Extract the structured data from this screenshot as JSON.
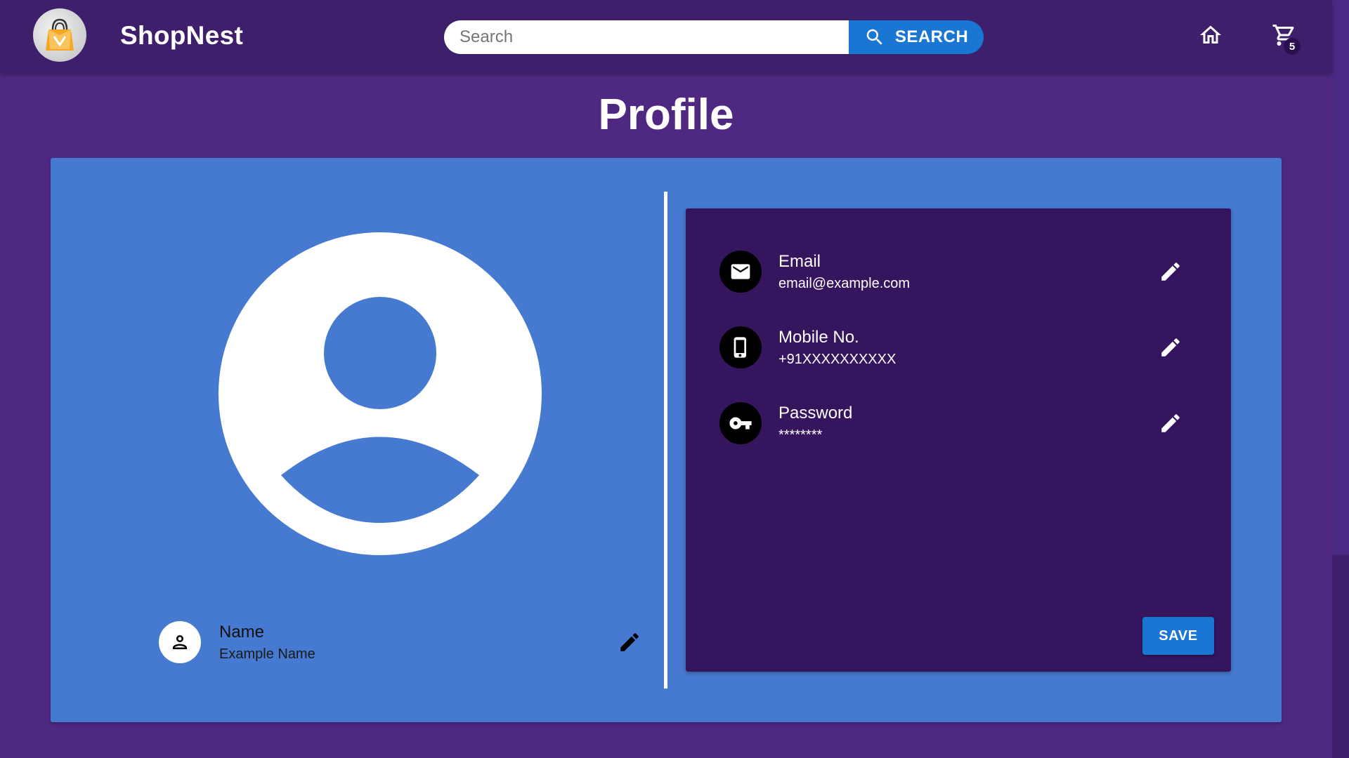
{
  "header": {
    "app_title": "ShopNest",
    "logo_icon": "shopping-bag-logo",
    "search": {
      "placeholder": "Search",
      "value": "",
      "button_label": "SEARCH",
      "button_icon": "search-icon"
    },
    "home_icon": "home-icon",
    "cart_icon": "cart-icon",
    "cart_count": "5"
  },
  "page": {
    "title": "Profile"
  },
  "profile": {
    "avatar_icon": "account-circle-icon",
    "name": {
      "label": "Name",
      "value": "Example Name",
      "icon": "person-icon",
      "edit_icon": "pencil-icon"
    }
  },
  "details": {
    "items": [
      {
        "label": "Email",
        "value": "email@example.com",
        "icon": "mail-icon",
        "edit_icon": "pencil-icon"
      },
      {
        "label": "Mobile No.",
        "value": "+91XXXXXXXXXX",
        "icon": "smartphone-icon",
        "edit_icon": "pencil-icon"
      },
      {
        "label": "Password",
        "value": "********",
        "icon": "key-icon",
        "edit_icon": "pencil-icon"
      }
    ],
    "save_label": "SAVE"
  },
  "colors": {
    "background": "#4f2882",
    "appbar": "#3e1f6c",
    "card": "#467ad0",
    "details_card": "#35155e",
    "primary_button": "#1976d2"
  }
}
